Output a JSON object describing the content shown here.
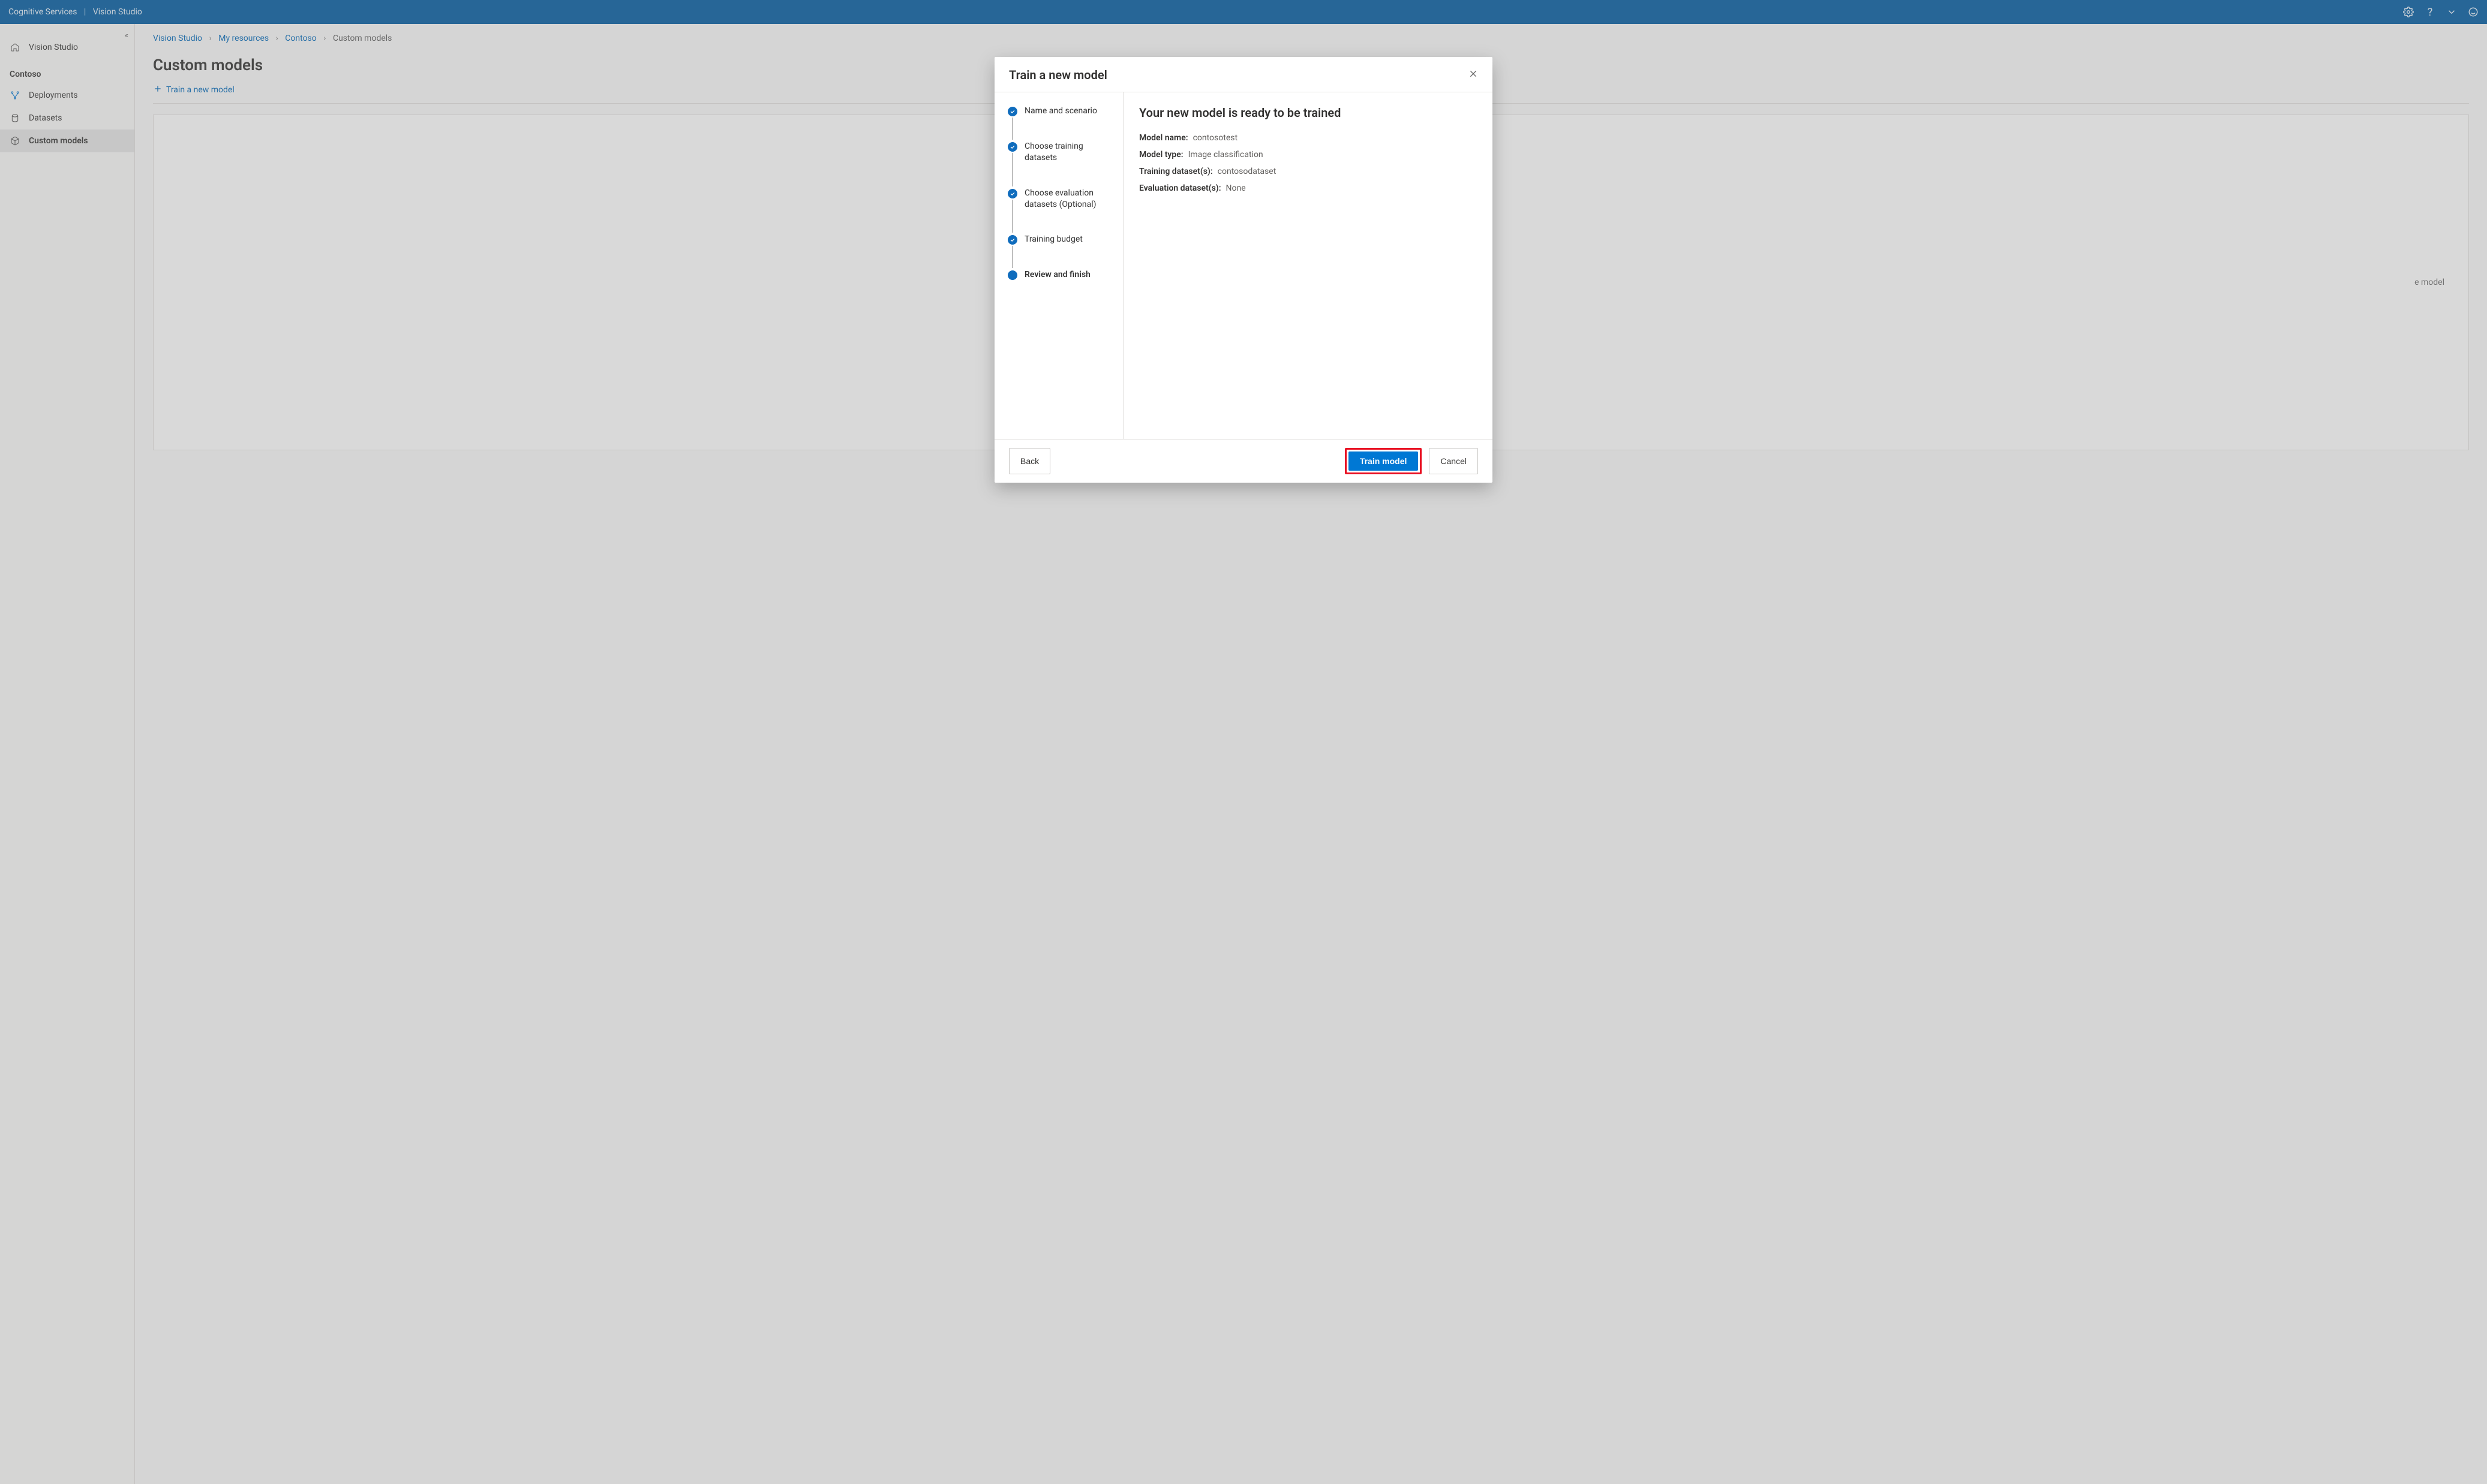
{
  "header": {
    "product": "Cognitive Services",
    "app": "Vision Studio"
  },
  "sidebar": {
    "root_label": "Vision Studio",
    "resource_name": "Contoso",
    "items": [
      {
        "label": "Deployments"
      },
      {
        "label": "Datasets"
      },
      {
        "label": "Custom models"
      }
    ]
  },
  "breadcrumb": {
    "items": [
      "Vision Studio",
      "My resources",
      "Contoso"
    ],
    "current": "Custom models"
  },
  "page": {
    "title": "Custom models",
    "toolbar_action": "Train a new model",
    "hint_fragment": "e model"
  },
  "modal": {
    "title": "Train a new model",
    "steps": [
      {
        "label": "Name and scenario",
        "state": "done"
      },
      {
        "label": "Choose training datasets",
        "state": "done"
      },
      {
        "label": "Choose evaluation datasets (Optional)",
        "state": "done"
      },
      {
        "label": "Training budget",
        "state": "done"
      },
      {
        "label": "Review and finish",
        "state": "current"
      }
    ],
    "review": {
      "headline": "Your new model is ready to be trained",
      "model_name_label": "Model name:",
      "model_name_value": "contosotest",
      "model_type_label": "Model type:",
      "model_type_value": "Image classification",
      "training_datasets_label": "Training dataset(s):",
      "training_datasets_value": "contosodataset",
      "eval_datasets_label": "Evaluation dataset(s):",
      "eval_datasets_value": "None"
    },
    "buttons": {
      "back": "Back",
      "primary": "Train model",
      "cancel": "Cancel"
    }
  }
}
